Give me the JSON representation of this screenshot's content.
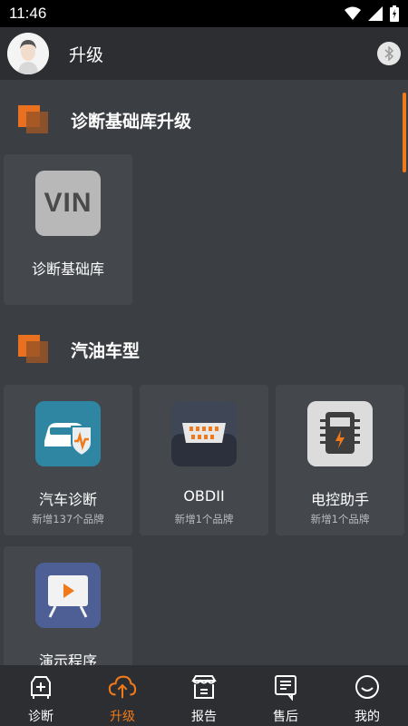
{
  "status_bar": {
    "time": "11:46"
  },
  "header": {
    "title": "升级"
  },
  "sections": [
    {
      "title": "诊断基础库升级",
      "cards": [
        {
          "title": "诊断基础库",
          "subtitle": "",
          "icon_text": "VIN",
          "icon": "vin-icon"
        }
      ]
    },
    {
      "title": "汽油车型",
      "cards": [
        {
          "title": "汽车诊断",
          "subtitle": "新增137个品牌",
          "icon": "car-diagnosis-icon"
        },
        {
          "title": "OBDII",
          "subtitle": "新增1个品牌",
          "icon": "obd-connector-icon"
        },
        {
          "title": "电控助手",
          "subtitle": "新增1个品牌",
          "icon": "ecu-helper-icon"
        },
        {
          "title": "演示程序",
          "subtitle": "",
          "icon": "demo-program-icon"
        }
      ]
    }
  ],
  "bottom_nav": [
    {
      "label": "诊断",
      "icon": "diagnosis-icon",
      "active": false
    },
    {
      "label": "升级",
      "icon": "cloud-upload-icon",
      "active": true
    },
    {
      "label": "报告",
      "icon": "report-icon",
      "active": false
    },
    {
      "label": "售后",
      "icon": "after-sales-icon",
      "active": false
    },
    {
      "label": "我的",
      "icon": "smile-icon",
      "active": false
    }
  ],
  "colors": {
    "accent": "#f07a1a",
    "background": "#3b3e43",
    "card": "#44474c",
    "bar": "#2c2e32"
  }
}
